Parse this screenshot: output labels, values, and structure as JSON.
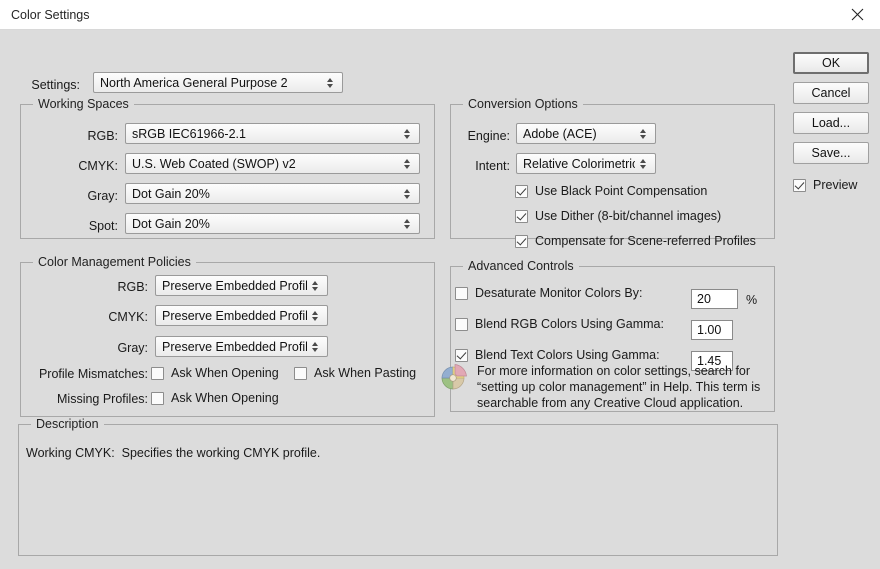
{
  "window": {
    "title": "Color Settings",
    "close_icon": "close-icon"
  },
  "settings_row": {
    "label": "Settings:",
    "value": "North America General Purpose 2"
  },
  "working_spaces": {
    "title": "Working Spaces",
    "rows": [
      {
        "label": "RGB:",
        "value": "sRGB IEC61966-2.1"
      },
      {
        "label": "CMYK:",
        "value": "U.S. Web Coated (SWOP) v2"
      },
      {
        "label": "Gray:",
        "value": "Dot Gain 20%"
      },
      {
        "label": "Spot:",
        "value": "Dot Gain 20%"
      }
    ]
  },
  "color_management_policies": {
    "title": "Color Management Policies",
    "rows": [
      {
        "label": "RGB:",
        "value": "Preserve Embedded Profiles"
      },
      {
        "label": "CMYK:",
        "value": "Preserve Embedded Profiles"
      },
      {
        "label": "Gray:",
        "value": "Preserve Embedded Profiles"
      }
    ],
    "profile_mismatches_label": "Profile Mismatches:",
    "ask_when_opening_1": {
      "label": "Ask When Opening",
      "checked": false
    },
    "ask_when_pasting": {
      "label": "Ask When Pasting",
      "checked": false
    },
    "missing_profiles_label": "Missing Profiles:",
    "ask_when_opening_2": {
      "label": "Ask When Opening",
      "checked": false
    }
  },
  "conversion_options": {
    "title": "Conversion Options",
    "engine_label": "Engine:",
    "engine_value": "Adobe (ACE)",
    "intent_label": "Intent:",
    "intent_value": "Relative Colorimetric",
    "checkboxes": [
      {
        "label": "Use Black Point Compensation",
        "checked": true
      },
      {
        "label": "Use Dither (8-bit/channel images)",
        "checked": true
      },
      {
        "label": "Compensate for Scene-referred Profiles",
        "checked": true
      }
    ]
  },
  "advanced_controls": {
    "title": "Advanced Controls",
    "rows": [
      {
        "label": "Desaturate Monitor Colors By:",
        "checked": false,
        "value": "20",
        "suffix": "%"
      },
      {
        "label": "Blend RGB Colors Using Gamma:",
        "checked": false,
        "value": "1.00",
        "suffix": ""
      },
      {
        "label": "Blend Text Colors Using Gamma:",
        "checked": true,
        "value": "1.45",
        "suffix": ""
      }
    ]
  },
  "info": {
    "icon": "color-wheel-icon",
    "text": "For more information on color settings, search for\n“setting up color management” in Help. This term is\nsearchable from any Creative Cloud application."
  },
  "description": {
    "title": "Description",
    "text": "Working CMYK:  Specifies the working CMYK profile."
  },
  "buttons": {
    "ok": "OK",
    "cancel": "Cancel",
    "load": "Load...",
    "save": "Save...",
    "preview": {
      "label": "Preview",
      "checked": true
    }
  },
  "colors": {
    "dialog_bg": "#dcdcdc",
    "titlebar_bg": "#ffffff",
    "group_border": "#a8a8a8",
    "field_bg": "#ffffff"
  }
}
